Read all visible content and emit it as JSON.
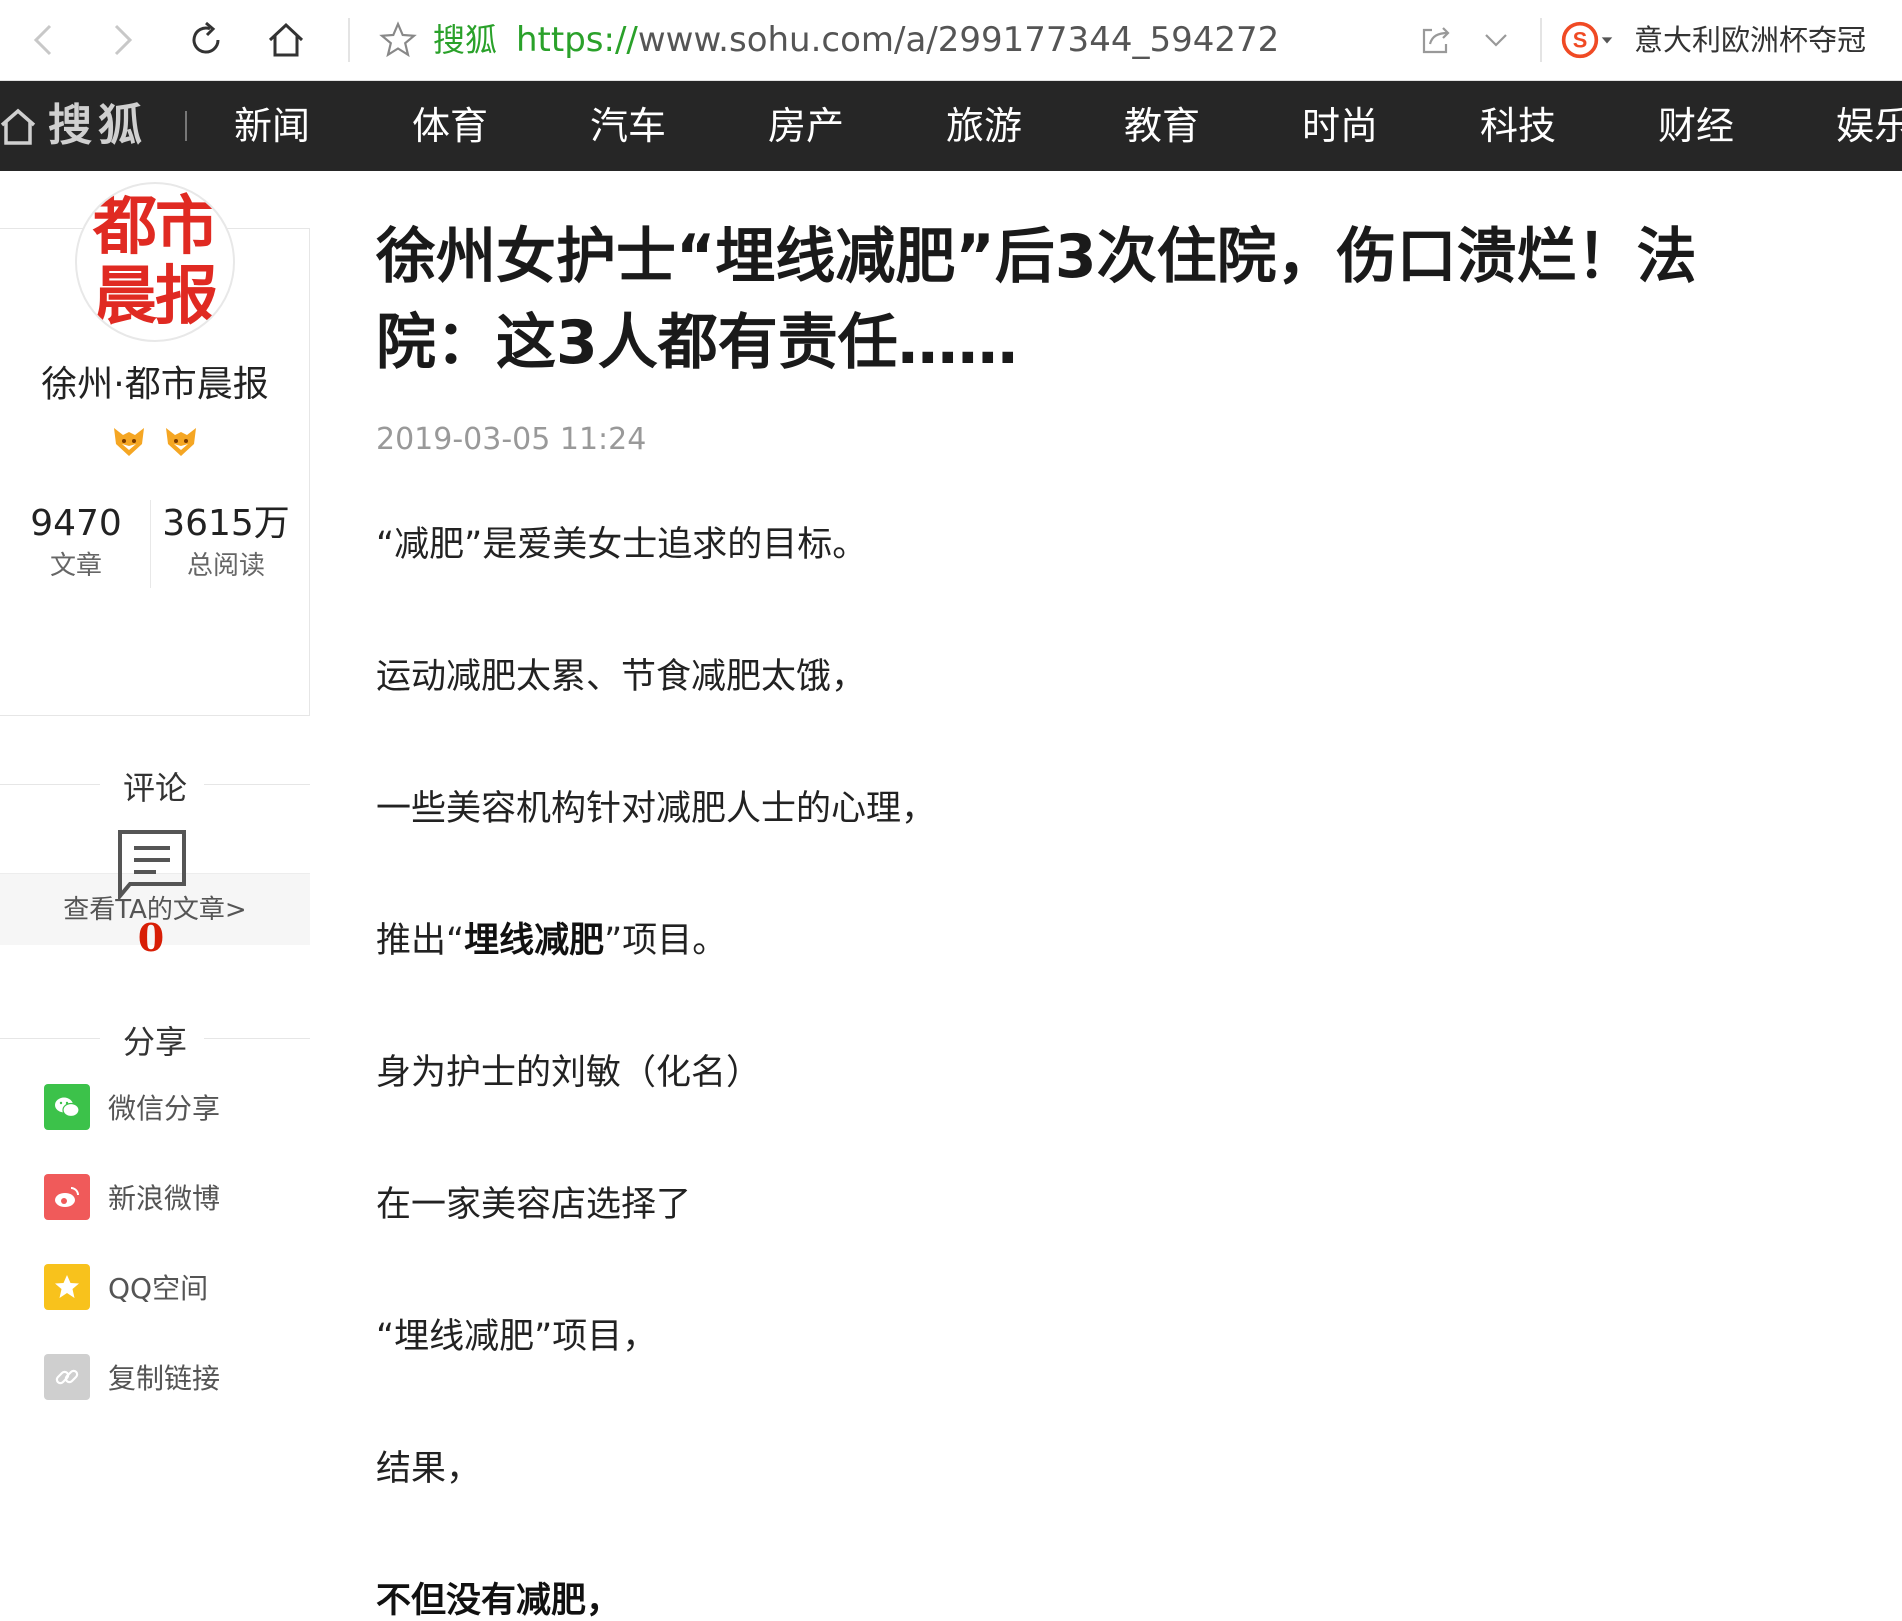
{
  "browser": {
    "site_name": "搜狐",
    "url_scheme": "https://",
    "url_rest": "www.sohu.com/a/299177344_594272",
    "search_text": "意大利欧洲杯夺冠"
  },
  "site_nav": {
    "logo": "搜狐",
    "items": [
      "新闻",
      "体育",
      "汽车",
      "房产",
      "旅游",
      "教育",
      "时尚",
      "科技",
      "财经",
      "娱乐"
    ]
  },
  "author": {
    "avatar_line1": "都市",
    "avatar_line2": "晨报",
    "name": "徐州·都市晨报",
    "articles_count": "9470",
    "articles_label": "文章",
    "reads_count": "3615万",
    "reads_label": "总阅读",
    "view_link": "查看TA的文章>"
  },
  "comments": {
    "title": "评论",
    "count": "0"
  },
  "share": {
    "title": "分享",
    "items": [
      {
        "label": "微信分享",
        "icon": "wechat-icon",
        "color": "#3cc24a"
      },
      {
        "label": "新浪微博",
        "icon": "weibo-icon",
        "color": "#f05a5a"
      },
      {
        "label": "QQ空间",
        "icon": "qzone-icon",
        "color": "#f8c21c"
      },
      {
        "label": "复制链接",
        "icon": "link-icon",
        "color": "#cfcfcf"
      }
    ]
  },
  "article": {
    "title": "徐州女护士“埋线减肥”后3次住院，伤口溃烂！法院：这3人都有责任……",
    "time": "2019-03-05 11:24",
    "p1": "“减肥”是爱美女士追求的目标。",
    "p2": "运动减肥太累、节食减肥太饿，",
    "p3": "一些美容机构针对减肥人士的心理，",
    "p4_pre": "推出“",
    "p4_bold": "埋线减肥",
    "p4_post": "”项目。",
    "p5": "身为护士的刘敏（化名）",
    "p6": "在一家美容店选择了",
    "p7": "“埋线减肥”项目，",
    "p8": "结果，",
    "p9": "不但没有减肥，"
  }
}
